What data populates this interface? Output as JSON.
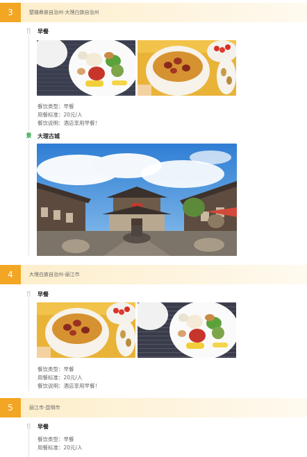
{
  "day3": {
    "number": "3",
    "route": "楚雄彝族自治州-大理白族自治州",
    "breakfast": {
      "icon": "utensils-icon",
      "title": "早餐",
      "type_line": "餐饮类型：早餐",
      "price_line": "用餐标准：20元/人",
      "note_line": "餐饮说明：酒店享用早餐！"
    },
    "sight": {
      "icon": "scenic-spot-icon",
      "icon_text": "景",
      "title": "大理古城"
    }
  },
  "day4": {
    "number": "4",
    "route": "大理白族自治州-丽江市",
    "breakfast": {
      "icon": "utensils-icon",
      "title": "早餐",
      "type_line": "餐饮类型：早餐",
      "price_line": "用餐标准：20元/人",
      "note_line": "餐饮说明：酒店享用早餐！"
    }
  },
  "day5": {
    "number": "5",
    "route": "丽江市-昆明市",
    "breakfast": {
      "icon": "utensils-icon",
      "title": "早餐",
      "type_line": "餐饮类型：早餐",
      "price_line": "用餐标准：20元/人"
    }
  },
  "colors": {
    "accent": "#f2a623",
    "route_bg": "#fdeecb",
    "meal_icon": "#e4652b",
    "sight_icon": "#36a44a"
  }
}
